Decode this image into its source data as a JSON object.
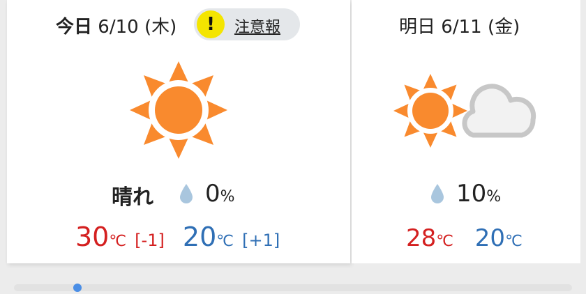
{
  "today": {
    "label": "今日",
    "date": "6/10",
    "weekday": "(木)",
    "alert": {
      "icon": "!",
      "label": "注意報"
    },
    "weather_icon": "sun-icon",
    "condition": "晴れ",
    "precip": {
      "icon": "raindrop-icon",
      "value": "0",
      "unit": "%"
    },
    "high": {
      "value": "30",
      "unit": "℃",
      "diff": "[-1]"
    },
    "low": {
      "value": "20",
      "unit": "℃",
      "diff": "[+1]"
    }
  },
  "tomorrow": {
    "label": "明日",
    "date": "6/11",
    "weekday": "(金)",
    "weather_icon": "sun-cloud-icon",
    "precip": {
      "icon": "raindrop-icon",
      "value": "10",
      "unit": "%"
    },
    "high": {
      "value": "28",
      "unit": "℃"
    },
    "low": {
      "value": "20",
      "unit": "℃"
    }
  },
  "colors": {
    "sun": "#f98a2e",
    "high_temp": "#d42020",
    "low_temp": "#2f6fb5",
    "alert_badge": "#f4e500",
    "scroll_thumb": "#4a8ee6"
  },
  "scroll": {
    "position": 0.11
  }
}
